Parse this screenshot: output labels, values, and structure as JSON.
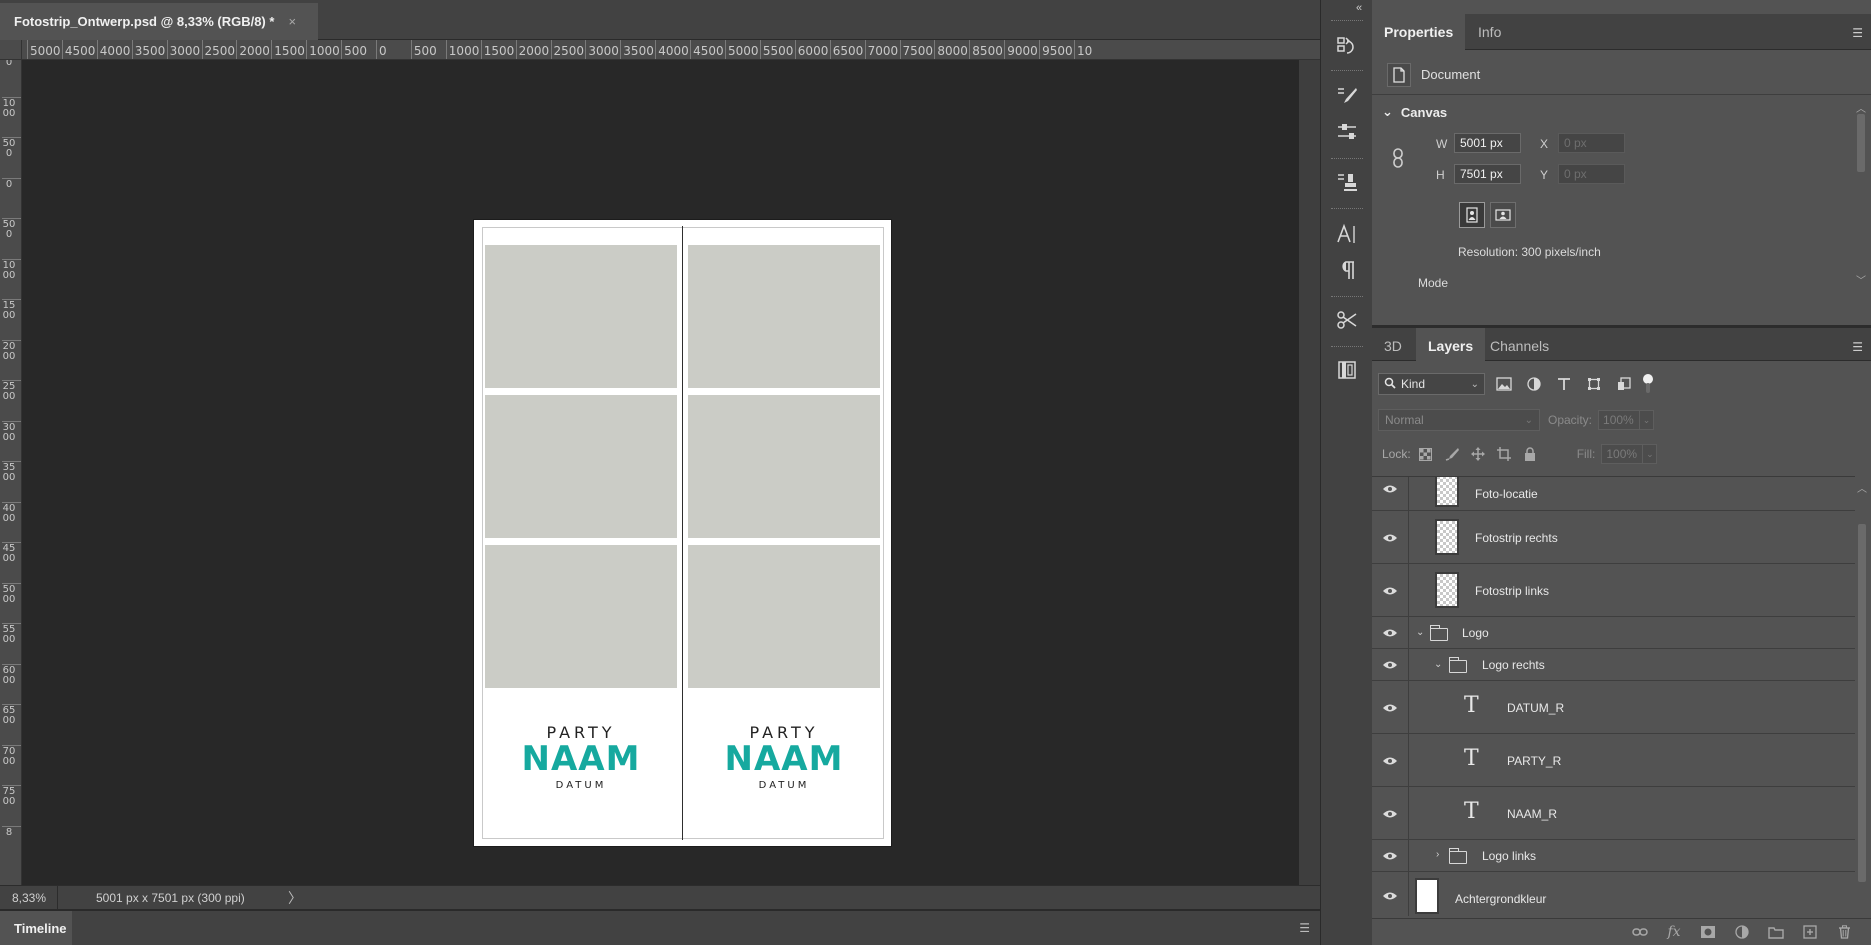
{
  "document": {
    "tab_title": "Fotostrip_Ontwerp.psd @ 8,33% (RGB/8) *",
    "close_glyph": "×"
  },
  "ruler": {
    "top_ticks": [
      "5000",
      "4500",
      "4000",
      "3500",
      "3000",
      "2500",
      "2000",
      "1500",
      "1000",
      "500",
      "0",
      "500",
      "1000",
      "1500",
      "2000",
      "2500",
      "3000",
      "3500",
      "4000",
      "4500",
      "5000",
      "5500",
      "6000",
      "6500",
      "7000",
      "7500",
      "8000",
      "8500",
      "9000",
      "9500",
      "10"
    ],
    "left_ticks": [
      "0",
      "1000",
      "500",
      "0",
      "500",
      "1000",
      "1500",
      "2000",
      "2500",
      "3000",
      "3500",
      "4000",
      "4500",
      "5000",
      "5500",
      "6000",
      "6500",
      "7000",
      "7500",
      "8"
    ]
  },
  "canvas": {
    "strips": [
      {
        "party": "PARTY",
        "naam": "NAAM",
        "datum": "DATUM"
      },
      {
        "party": "PARTY",
        "naam": "NAAM",
        "datum": "DATUM"
      }
    ],
    "photo_color": "#cbccc6",
    "brand_color": "#16a99f"
  },
  "status": {
    "zoom": "8,33%",
    "doc_info": "5001 px x 7501 px (300 ppi)",
    "arrow": "〉"
  },
  "timeline": {
    "label": "Timeline",
    "menu_icon": "menu-icon"
  },
  "mid_strip": {
    "collapse": "«",
    "icons": [
      "history-icon",
      "brush-settings-icon",
      "adjustments-icon",
      "clone-stamp-icon",
      "character-icon",
      "paragraph-icon",
      "tool-presets-icon",
      "libraries-icon"
    ]
  },
  "properties": {
    "tabs": [
      "Properties",
      "Info"
    ],
    "doc_label": "Document",
    "section": "Canvas",
    "w_label": "W",
    "w_value": "5001 px",
    "h_label": "H",
    "h_value": "7501 px",
    "x_label": "X",
    "x_placeholder": "0 px",
    "y_label": "Y",
    "y_placeholder": "0 px",
    "resolution": "Resolution: 300 pixels/inch",
    "mode": "Mode"
  },
  "layers_panel": {
    "tabs": [
      "3D",
      "Layers",
      "Channels"
    ],
    "kind_label": "Kind",
    "blend_mode": "Normal",
    "opacity_label": "Opacity:",
    "opacity_value": "100%",
    "lock_label": "Lock:",
    "fill_label": "Fill:",
    "fill_value": "100%",
    "layers": [
      {
        "name": "Foto-locatie",
        "kind": "pixel"
      },
      {
        "name": "Fotostrip rechts",
        "kind": "pixel"
      },
      {
        "name": "Fotostrip links",
        "kind": "pixel"
      },
      {
        "name": "Logo",
        "kind": "group",
        "expanded": true
      },
      {
        "name": "Logo rechts",
        "kind": "group",
        "expanded": true
      },
      {
        "name": "DATUM_R",
        "kind": "text"
      },
      {
        "name": "PARTY_R",
        "kind": "text"
      },
      {
        "name": "NAAM_R",
        "kind": "text"
      },
      {
        "name": "Logo links",
        "kind": "group",
        "expanded": false
      },
      {
        "name": "Achtergrondkleur",
        "kind": "fill"
      }
    ]
  }
}
